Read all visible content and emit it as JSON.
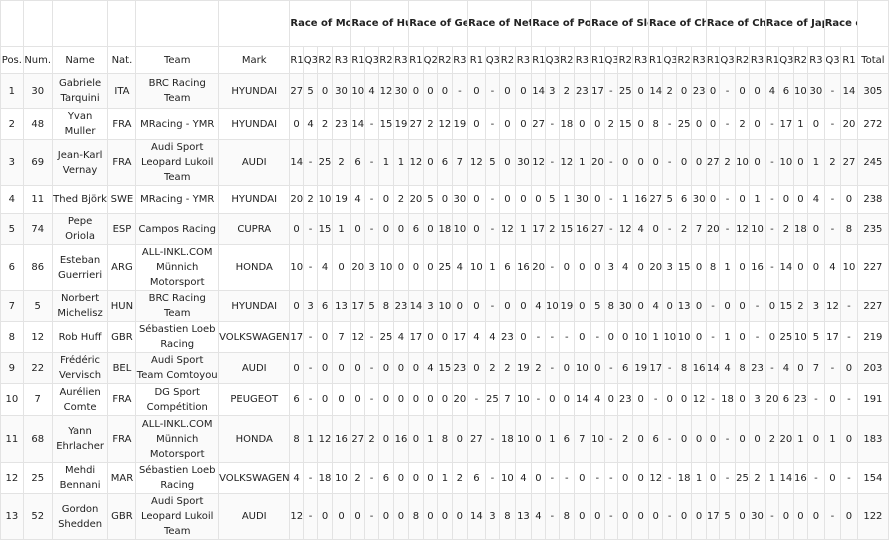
{
  "header": {
    "pos": "Pos.",
    "num": "Num.",
    "name": "Name",
    "nat": "Nat.",
    "team": "Team",
    "mark": "Mark",
    "total": "Total",
    "races": [
      {
        "name": "Race of Morocco",
        "cols": [
          "R1",
          "Q3",
          "R2",
          "R3"
        ]
      },
      {
        "name": "Race of Hungary",
        "cols": [
          "R1",
          "Q3",
          "R2",
          "R3"
        ]
      },
      {
        "name": "Race of Germany",
        "cols": [
          "R1",
          "Q2",
          "R2",
          "R3"
        ]
      },
      {
        "name": "Race of Netherlands",
        "cols": [
          "R1",
          "Q3",
          "R2",
          "R3"
        ]
      },
      {
        "name": "Race of Portugal",
        "cols": [
          "R1",
          "Q3",
          "R2",
          "R3"
        ]
      },
      {
        "name": "Race of Slovakia",
        "cols": [
          "R1",
          "Q3",
          "R2",
          "R3"
        ]
      },
      {
        "name": "Race of China-Ningbo",
        "cols": [
          "R1",
          "Q3",
          "R2",
          "R3"
        ]
      },
      {
        "name": "Race of China-Wuhan",
        "cols": [
          "R1",
          "Q3",
          "R2",
          "R3"
        ]
      },
      {
        "name": "Race of Japan",
        "cols": [
          "R1",
          "Q3",
          "R2",
          "R3"
        ]
      },
      {
        "name": "Race of Macau",
        "cols": [
          "Q3",
          "R1"
        ]
      }
    ]
  },
  "rows": [
    {
      "pos": "1",
      "num": "30",
      "name": "Gabriele Tarquini",
      "nat": "ITA",
      "team": "BRC Racing Team",
      "mark": "HYUNDAI",
      "results": [
        "27",
        "5",
        "0",
        "30",
        "10",
        "4",
        "12",
        "30",
        "0",
        "0",
        "0",
        "-",
        "0",
        "-",
        "0",
        "0",
        "14",
        "3",
        "2",
        "23",
        "17",
        "-",
        "25",
        "0",
        "14",
        "2",
        "0",
        "23",
        "0",
        "-",
        "0",
        "0",
        "4",
        "6",
        "10",
        "30",
        "-",
        "14"
      ],
      "total": "305"
    },
    {
      "pos": "2",
      "num": "48",
      "name": "Yvan Muller",
      "nat": "FRA",
      "team": "MRacing - YMR",
      "mark": "HYUNDAI",
      "results": [
        "0",
        "4",
        "2",
        "23",
        "14",
        "-",
        "15",
        "19",
        "27",
        "2",
        "12",
        "19",
        "0",
        "-",
        "0",
        "0",
        "27",
        "-",
        "18",
        "0",
        "0",
        "2",
        "15",
        "0",
        "8",
        "-",
        "25",
        "0",
        "0",
        "-",
        "2",
        "0",
        "-",
        "17",
        "1",
        "0",
        "-",
        "20"
      ],
      "total": "272"
    },
    {
      "pos": "3",
      "num": "69",
      "name": "Jean-Karl Vernay",
      "nat": "FRA",
      "team": "Audi Sport Leopard Lukoil Team",
      "mark": "AUDI",
      "results": [
        "14",
        "-",
        "25",
        "2",
        "6",
        "-",
        "1",
        "1",
        "12",
        "0",
        "6",
        "7",
        "12",
        "5",
        "0",
        "30",
        "12",
        "-",
        "12",
        "1",
        "20",
        "-",
        "0",
        "0",
        "0",
        "-",
        "0",
        "0",
        "27",
        "2",
        "10",
        "0",
        "-",
        "10",
        "0",
        "1",
        "2",
        "27"
      ],
      "total": "245"
    },
    {
      "pos": "4",
      "num": "11",
      "name": "Thed Björk",
      "nat": "SWE",
      "team": "MRacing - YMR",
      "mark": "HYUNDAI",
      "results": [
        "20",
        "2",
        "10",
        "19",
        "4",
        "-",
        "0",
        "2",
        "20",
        "5",
        "0",
        "30",
        "0",
        "-",
        "0",
        "0",
        "0",
        "5",
        "1",
        "30",
        "0",
        "-",
        "1",
        "16",
        "27",
        "5",
        "6",
        "30",
        "0",
        "-",
        "0",
        "1",
        "-",
        "0",
        "0",
        "4",
        "-",
        "0"
      ],
      "total": "238"
    },
    {
      "pos": "5",
      "num": "74",
      "name": "Pepe Oriola",
      "nat": "ESP",
      "team": "Campos Racing",
      "mark": "CUPRA",
      "results": [
        "0",
        "-",
        "15",
        "1",
        "0",
        "-",
        "0",
        "0",
        "6",
        "0",
        "18",
        "10",
        "0",
        "-",
        "12",
        "1",
        "17",
        "2",
        "15",
        "16",
        "27",
        "-",
        "12",
        "4",
        "0",
        "-",
        "2",
        "7",
        "20",
        "-",
        "12",
        "10",
        "-",
        "2",
        "18",
        "0",
        "-",
        "8"
      ],
      "total": "235"
    },
    {
      "pos": "6",
      "num": "86",
      "name": "Esteban Guerrieri",
      "nat": "ARG",
      "team": "ALL-INKL.COM Münnich Motorsport",
      "mark": "HONDA",
      "results": [
        "10",
        "-",
        "4",
        "0",
        "20",
        "3",
        "10",
        "0",
        "0",
        "0",
        "25",
        "4",
        "10",
        "1",
        "6",
        "16",
        "20",
        "-",
        "0",
        "0",
        "0",
        "3",
        "4",
        "0",
        "20",
        "3",
        "15",
        "0",
        "8",
        "1",
        "0",
        "16",
        "-",
        "14",
        "0",
        "0",
        "4",
        "10"
      ],
      "total": "227"
    },
    {
      "pos": "7",
      "num": "5",
      "name": "Norbert Michelisz",
      "nat": "HUN",
      "team": "BRC Racing Team",
      "mark": "HYUNDAI",
      "results": [
        "0",
        "3",
        "6",
        "13",
        "17",
        "5",
        "8",
        "23",
        "14",
        "3",
        "10",
        "0",
        "0",
        "-",
        "0",
        "0",
        "4",
        "10",
        "19",
        "0",
        "5",
        "8",
        "30",
        "0",
        "4",
        "0",
        "13",
        "0",
        "-",
        "0",
        "0",
        "-",
        "0",
        "15",
        "2",
        "3",
        "12",
        "-"
      ],
      "total": "227"
    },
    {
      "pos": "8",
      "num": "12",
      "name": "Rob Huff",
      "nat": "GBR",
      "team": "Sébastien Loeb Racing",
      "mark": "VOLKSWAGEN",
      "results": [
        "17",
        "-",
        "0",
        "7",
        "12",
        "-",
        "25",
        "4",
        "17",
        "0",
        "0",
        "17",
        "4",
        "4",
        "23",
        "0",
        "-",
        "-",
        "-",
        "0",
        "-",
        "0",
        "0",
        "10",
        "1",
        "10",
        "10",
        "0",
        "-",
        "1",
        "0",
        "-",
        "0",
        "25",
        "10",
        "5",
        "17",
        "-"
      ],
      "total": "219"
    },
    {
      "pos": "9",
      "num": "22",
      "name": "Frédéric Vervisch",
      "nat": "BEL",
      "team": "Audi Sport Team Comtoyou",
      "mark": "AUDI",
      "results": [
        "0",
        "-",
        "0",
        "0",
        "0",
        "-",
        "0",
        "0",
        "0",
        "4",
        "15",
        "23",
        "0",
        "2",
        "2",
        "19",
        "2",
        "-",
        "0",
        "10",
        "0",
        "-",
        "6",
        "19",
        "17",
        "-",
        "8",
        "16",
        "14",
        "4",
        "8",
        "23",
        "-",
        "4",
        "0",
        "7",
        "-",
        "0"
      ],
      "total": "203"
    },
    {
      "pos": "10",
      "num": "7",
      "name": "Aurélien Comte",
      "nat": "FRA",
      "team": "DG Sport Compétition",
      "mark": "PEUGEOT",
      "results": [
        "6",
        "-",
        "0",
        "0",
        "0",
        "-",
        "0",
        "0",
        "0",
        "0",
        "0",
        "20",
        "-",
        "25",
        "7",
        "10",
        "-",
        "0",
        "0",
        "14",
        "4",
        "0",
        "23",
        "0",
        "-",
        "0",
        "0",
        "12",
        "-",
        "18",
        "0",
        "3",
        "20",
        "6",
        "23",
        "-",
        "0",
        "-"
      ],
      "total": "191"
    },
    {
      "pos": "11",
      "num": "68",
      "name": "Yann Ehrlacher",
      "nat": "FRA",
      "team": "ALL-INKL.COM Münnich Motorsport",
      "mark": "HONDA",
      "results": [
        "8",
        "1",
        "12",
        "16",
        "27",
        "2",
        "0",
        "16",
        "0",
        "1",
        "8",
        "0",
        "27",
        "-",
        "18",
        "10",
        "0",
        "1",
        "6",
        "7",
        "10",
        "-",
        "2",
        "0",
        "6",
        "-",
        "0",
        "0",
        "0",
        "-",
        "0",
        "0",
        "2",
        "20",
        "1",
        "0",
        "1",
        "0"
      ],
      "total": "183"
    },
    {
      "pos": "12",
      "num": "25",
      "name": "Mehdi Bennani",
      "nat": "MAR",
      "team": "Sébastien Loeb Racing",
      "mark": "VOLKSWAGEN",
      "results": [
        "4",
        "-",
        "18",
        "10",
        "2",
        "-",
        "6",
        "0",
        "0",
        "0",
        "1",
        "2",
        "6",
        "-",
        "10",
        "4",
        "0",
        "-",
        "-",
        "0",
        "-",
        "-",
        "0",
        "0",
        "12",
        "-",
        "18",
        "1",
        "0",
        "-",
        "25",
        "2",
        "1",
        "14",
        "16",
        "-",
        "0",
        "-"
      ],
      "total": "154"
    },
    {
      "pos": "13",
      "num": "52",
      "name": "Gordon Shedden",
      "nat": "GBR",
      "team": "Audi Sport Leopard Lukoil Team",
      "mark": "AUDI",
      "results": [
        "12",
        "-",
        "0",
        "0",
        "0",
        "-",
        "0",
        "0",
        "8",
        "0",
        "0",
        "0",
        "14",
        "3",
        "8",
        "13",
        "4",
        "-",
        "8",
        "0",
        "0",
        "-",
        "0",
        "0",
        "0",
        "-",
        "0",
        "0",
        "17",
        "5",
        "0",
        "30",
        "-",
        "0",
        "0",
        "0",
        "-",
        "0"
      ],
      "total": "122"
    }
  ]
}
